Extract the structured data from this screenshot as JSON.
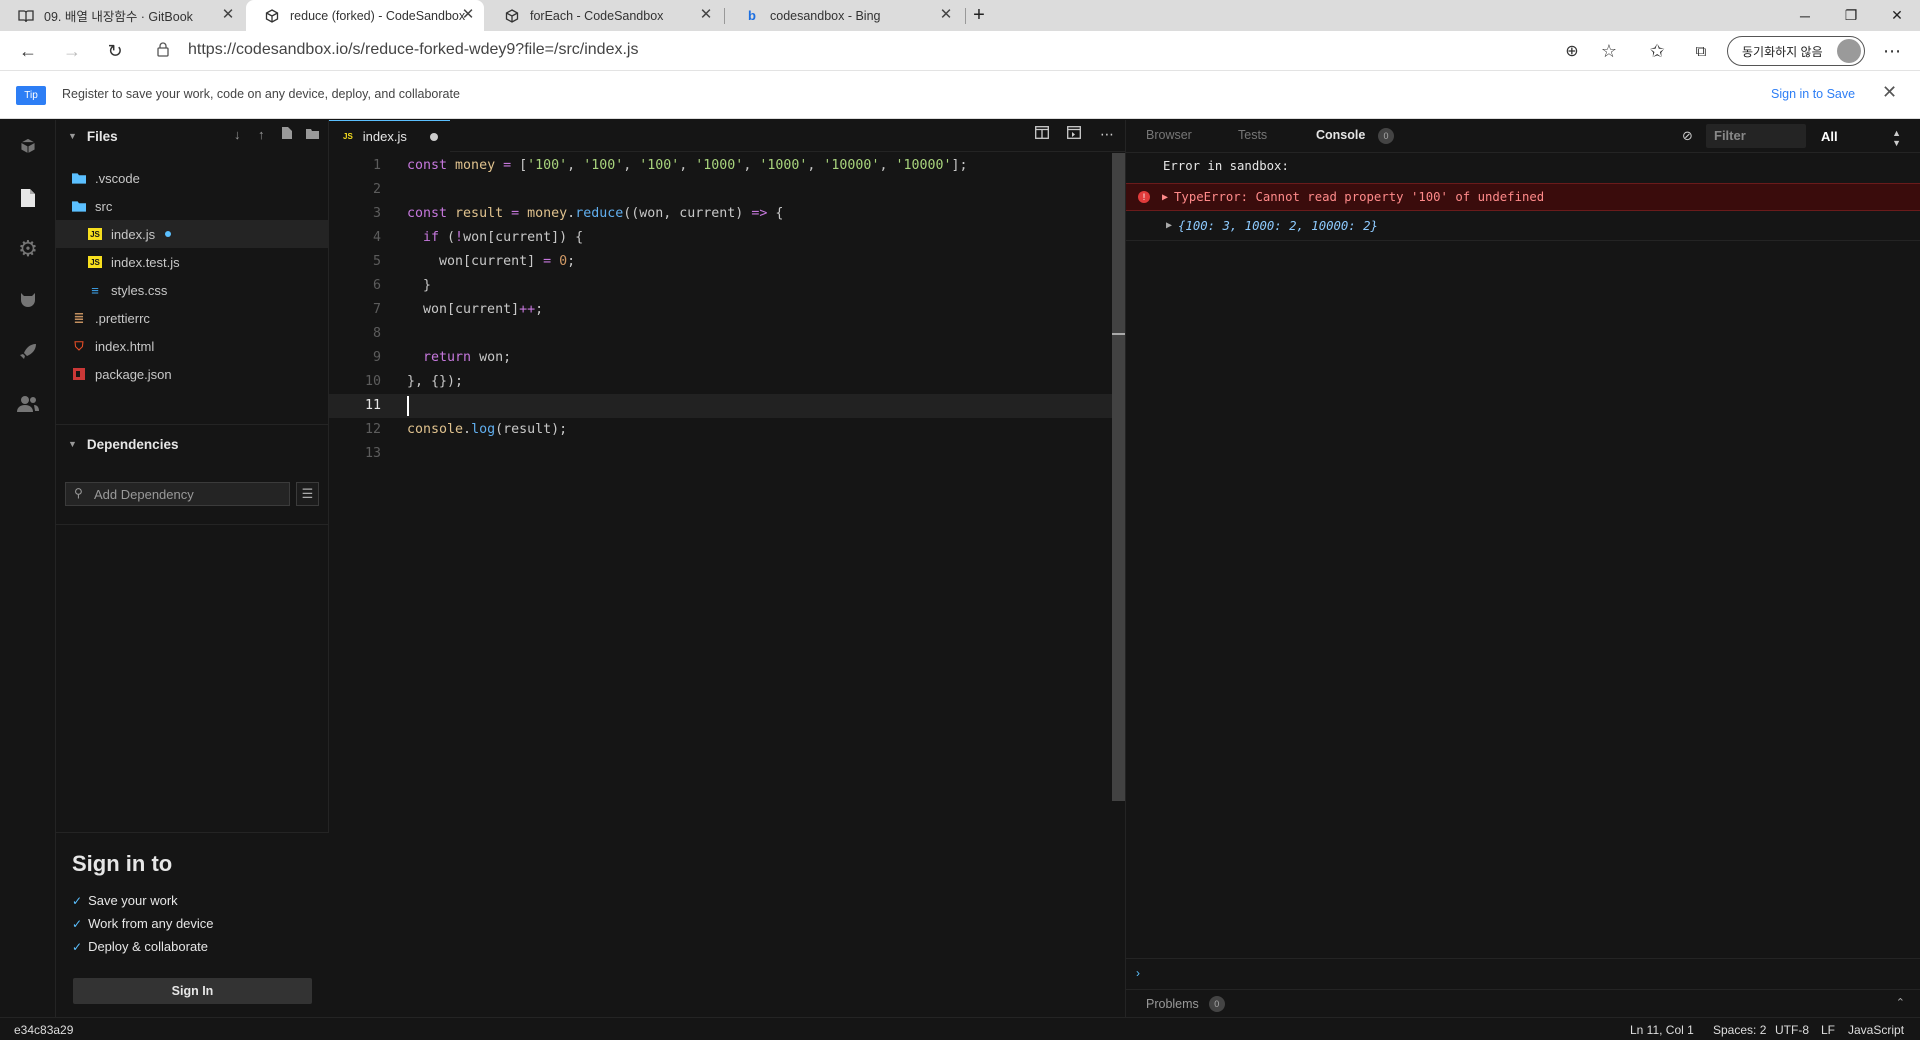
{
  "browser": {
    "tabs": [
      {
        "title": "09. 배열 내장함수 · GitBook",
        "icon": "book-icon"
      },
      {
        "title": "reduce (forked) - CodeSandbox",
        "icon": "codesandbox-icon"
      },
      {
        "title": "forEach - CodeSandbox",
        "icon": "codesandbox-icon"
      },
      {
        "title": "codesandbox - Bing",
        "icon": "bing-icon"
      }
    ],
    "active_tab": 1,
    "url": "https://codesandbox.io/s/reduce-forked-wdey9?file=/src/index.js",
    "sync_label": "동기화하지 않음"
  },
  "tip": {
    "badge": "Tip",
    "text": "Register to save your work, code on any device, deploy, and collaborate",
    "sign_in_label": "Sign in to Save"
  },
  "sidebar": {
    "files_title": "Files",
    "files": [
      {
        "name": ".vscode",
        "type": "folder",
        "icon": "folder-icon"
      },
      {
        "name": "src",
        "type": "folder",
        "icon": "folder-open-icon"
      },
      {
        "name": "index.js",
        "type": "js",
        "icon": "js-file-icon"
      },
      {
        "name": "index.test.js",
        "type": "js",
        "icon": "js-file-icon"
      },
      {
        "name": "styles.css",
        "type": "css",
        "icon": "css-file-icon"
      },
      {
        "name": ".prettierrc",
        "type": "config",
        "icon": "config-file-icon"
      },
      {
        "name": "index.html",
        "type": "html",
        "icon": "html-file-icon"
      },
      {
        "name": "package.json",
        "type": "json",
        "icon": "npm-file-icon"
      }
    ],
    "dependencies_title": "Dependencies",
    "add_dependency_placeholder": "Add Dependency",
    "signin": {
      "title": "Sign in to",
      "items": [
        "Save your work",
        "Work from any device",
        "Deploy & collaborate"
      ],
      "button": "Sign In"
    }
  },
  "editor": {
    "tab_label": "index.js",
    "tab_badge": "JS",
    "line_numbers": [
      "1",
      "2",
      "3",
      "4",
      "5",
      "6",
      "7",
      "8",
      "9",
      "10",
      "11",
      "12",
      "13"
    ],
    "current_line": 11,
    "code_lines": [
      "const money = ['100', '100', '100', '1000', '1000', '10000', '10000'];",
      "",
      "const result = money.reduce((won, current) => {",
      "  if (!won[current]) {",
      "    won[current] = 0;",
      "  }",
      "  won[current]++;",
      "",
      "  return won;",
      "}, {});",
      "",
      "console.log(result);",
      ""
    ]
  },
  "preview": {
    "tabs": [
      "Browser",
      "Tests",
      "Console"
    ],
    "console_count": "0",
    "filter_placeholder": "Filter",
    "level_select": "All",
    "console": {
      "header": "Error in sandbox:",
      "error": "TypeError: Cannot read property '100' of undefined",
      "object": "{100: 3, 1000: 2, 10000: 2}"
    },
    "problems_label": "Problems",
    "problems_count": "0"
  },
  "status": {
    "commit": "e34c83a29",
    "position": "Ln 11, Col 1",
    "spaces": "Spaces: 2",
    "encoding": "UTF-8",
    "eol": "LF",
    "language": "JavaScript"
  }
}
